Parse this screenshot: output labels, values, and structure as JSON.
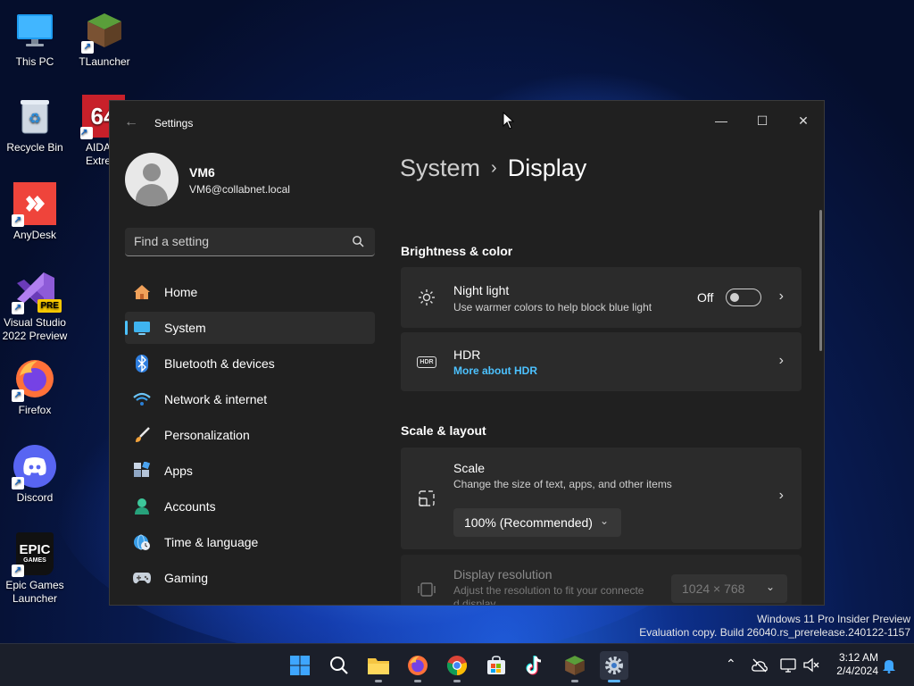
{
  "desktop": {
    "icons": [
      {
        "label": "This PC",
        "icon": "monitor-icon"
      },
      {
        "label": "TLauncher",
        "icon": "minecraft-block-icon"
      },
      {
        "label": "Recycle Bin",
        "icon": "recycle-bin-icon"
      },
      {
        "label": "AIDA",
        "label2": "Extre",
        "icon": "aida64-icon",
        "badge": "64"
      },
      {
        "label": "AnyDesk",
        "icon": "anydesk-icon"
      },
      {
        "label": "Visual Studio 2022 Preview",
        "icon": "visual-studio-icon",
        "badge": "PRE"
      },
      {
        "label": "Firefox",
        "icon": "firefox-icon"
      },
      {
        "label": "Discord",
        "icon": "discord-icon"
      },
      {
        "label": "Epic Games Launcher",
        "icon": "epic-games-icon",
        "badge_line1": "EPIC",
        "badge_line2": "GAMES"
      }
    ]
  },
  "window": {
    "title": "Settings",
    "back_glyph": "←",
    "controls": {
      "minimize": "—",
      "maximize": "☐",
      "close": "✕"
    }
  },
  "profile": {
    "name": "VM6",
    "email": "VM6@collabnet.local"
  },
  "search": {
    "placeholder": "Find a setting"
  },
  "nav": [
    {
      "label": "Home",
      "icon": "home-icon"
    },
    {
      "label": "System",
      "icon": "system-icon",
      "active": true
    },
    {
      "label": "Bluetooth & devices",
      "icon": "bluetooth-icon"
    },
    {
      "label": "Network & internet",
      "icon": "wifi-icon"
    },
    {
      "label": "Personalization",
      "icon": "brush-icon"
    },
    {
      "label": "Apps",
      "icon": "apps-icon"
    },
    {
      "label": "Accounts",
      "icon": "accounts-icon"
    },
    {
      "label": "Time & language",
      "icon": "globe-clock-icon"
    },
    {
      "label": "Gaming",
      "icon": "gamepad-icon"
    }
  ],
  "breadcrumb": {
    "parent": "System",
    "separator": "›",
    "current": "Display"
  },
  "sections": {
    "brightness": {
      "heading": "Brightness & color",
      "night_light": {
        "title": "Night light",
        "subtitle": "Use warmer colors to help block blue light",
        "toggle_label": "Off",
        "toggle_on": false
      },
      "hdr": {
        "title": "HDR",
        "link": "More about HDR",
        "icon_text": "HDR"
      }
    },
    "scale_layout": {
      "heading": "Scale & layout",
      "scale": {
        "title": "Scale",
        "subtitle": "Change the size of text, apps, and other items",
        "value": "100% (Recommended)"
      },
      "resolution": {
        "title": "Display resolution",
        "subtitle_1": "Adjust the resolution to fit your connecte",
        "subtitle_2": "d display",
        "value": "1024 × 768"
      }
    }
  },
  "watermark": {
    "line1": "Windows 11 Pro Insider Preview",
    "line2": "Evaluation copy. Build 26040.rs_prerelease.240122-1157"
  },
  "taskbar": {
    "apps": [
      {
        "name": "start",
        "icon": "windows-start-icon"
      },
      {
        "name": "search",
        "icon": "search-icon"
      },
      {
        "name": "file-explorer",
        "icon": "folder-icon"
      },
      {
        "name": "firefox",
        "icon": "firefox-icon"
      },
      {
        "name": "chrome",
        "icon": "chrome-icon"
      },
      {
        "name": "store",
        "icon": "store-icon"
      },
      {
        "name": "tiktok",
        "icon": "tiktok-icon"
      },
      {
        "name": "minecraft",
        "icon": "minecraft-icon"
      },
      {
        "name": "settings",
        "icon": "gear-icon",
        "active": true
      }
    ],
    "clock": {
      "time": "3:12 AM",
      "date": "2/4/2024"
    }
  },
  "colors": {
    "accent": "#4cc2ff",
    "window_bg": "#202020",
    "card_bg": "#2b2b2b"
  }
}
